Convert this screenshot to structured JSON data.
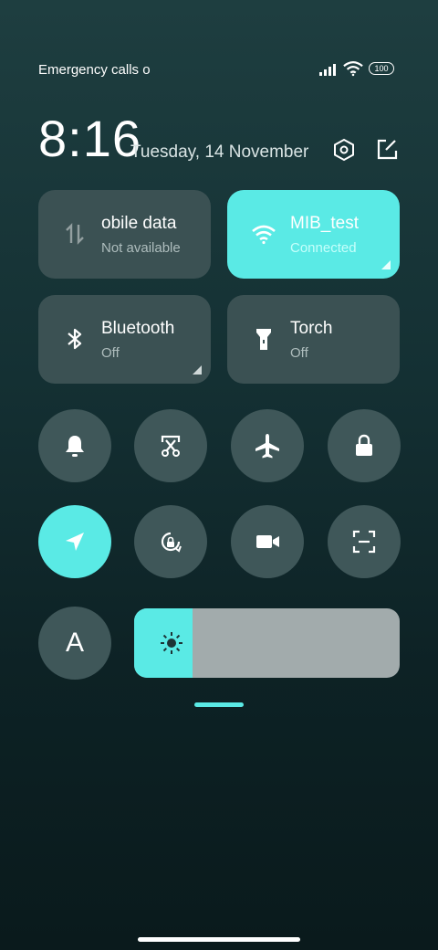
{
  "status": {
    "carrier_text": "Emergency calls o",
    "battery": "100"
  },
  "header": {
    "time": "8:16",
    "date": "Tuesday, 14 November"
  },
  "tiles": [
    {
      "title": "obile data",
      "subtitle": "Not available",
      "icon": "mobile-data-icon",
      "active": false
    },
    {
      "title": "MIB_test",
      "subtitle": "Connected",
      "icon": "wifi-icon",
      "active": true
    },
    {
      "title": "Bluetooth",
      "subtitle": "Off",
      "icon": "bluetooth-icon",
      "active": false
    },
    {
      "title": "Torch",
      "subtitle": "Off",
      "icon": "torch-icon",
      "active": false
    }
  ],
  "toggles": [
    {
      "name": "bell-icon",
      "active": false
    },
    {
      "name": "screenshot-icon",
      "active": false
    },
    {
      "name": "airplane-icon",
      "active": false
    },
    {
      "name": "lock-icon",
      "active": false
    },
    {
      "name": "location-icon",
      "active": true
    },
    {
      "name": "rotation-lock-icon",
      "active": false
    },
    {
      "name": "video-camera-icon",
      "active": false
    },
    {
      "name": "scanner-icon",
      "active": false
    },
    {
      "name": "auto-brightness-icon",
      "active": false
    }
  ],
  "toggle_labels": {
    "auto_brightness": "A"
  },
  "brightness": {
    "level": 0.22
  },
  "colors": {
    "accent": "#5aeae5",
    "tile": "#3b5153",
    "circle": "#3f5759",
    "slider_track": "#a2abac"
  }
}
